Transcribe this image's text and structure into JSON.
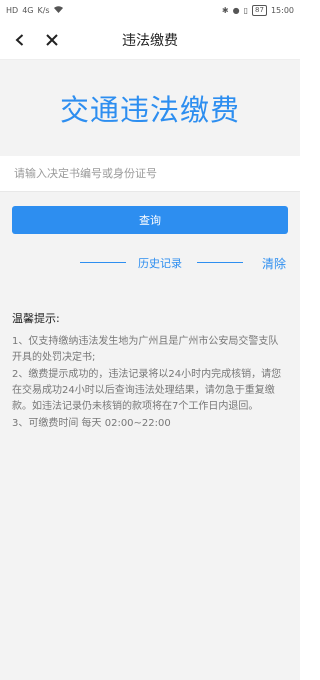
{
  "status_bar": {
    "left_icons": [
      "HD",
      "4G",
      "K/s"
    ],
    "right_icons": [
      "bluetooth-icon",
      "location-icon",
      "vibrate-icon"
    ],
    "battery": "87",
    "time": "15:00"
  },
  "navbar": {
    "title": "违法缴费"
  },
  "banner": {
    "title": "交通违法缴费"
  },
  "search": {
    "placeholder": "请输入决定书编号或身份证号",
    "value": ""
  },
  "query_button": {
    "label": "查询"
  },
  "history": {
    "label": "历史记录",
    "clear_label": "清除"
  },
  "tips": {
    "title": "温馨提示:",
    "items": [
      "1、仅支持缴纳违法发生地为广州且是广州市公安局交警支队开具的处罚决定书;",
      "2、缴费提示成功的，违法记录将以24小时内完成核销，请您在交易成功24小时以后查询违法处理结果，请勿急于重复缴款。如违法记录仍未核销的款项将在7个工作日内退回。",
      "3、可缴费时间 每天 02:00~22:00"
    ]
  },
  "colors": {
    "accent": "#2d8ef0",
    "background": "#f3f3f3"
  }
}
